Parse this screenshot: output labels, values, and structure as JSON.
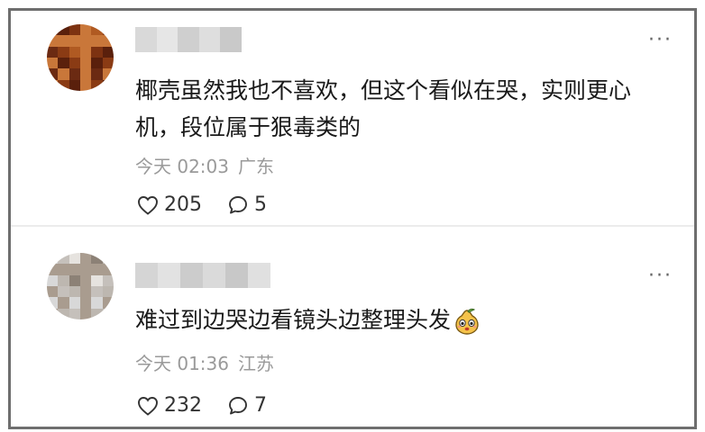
{
  "comments": [
    {
      "text": "椰壳虽然我也不喜欢，但这个看似在哭，实则更心机，段位属于狠毒类的",
      "time": "今天 02:03",
      "location": "广东",
      "likes": "205",
      "replies": "5",
      "avatar_colors": [
        "#6b2a12",
        "#8a3b14",
        "#b05a22",
        "#c9773a",
        "#7d3211",
        "#5a200c"
      ],
      "username_colors": [
        "#d9d9d9",
        "#e6e6e6",
        "#cfcfcf",
        "#dedede",
        "#c9c9c9"
      ]
    },
    {
      "text": "难过到边哭边看镜头边整理头发",
      "time": "今天 01:36",
      "location": "江苏",
      "likes": "232",
      "replies": "7",
      "avatar_colors": [
        "#d8d8d8",
        "#bdb7b0",
        "#8c8176",
        "#a99c8f",
        "#e6e3df",
        "#c5c0bb"
      ],
      "username_colors": [
        "#d5d5d5",
        "#e2e2e2",
        "#cccccc",
        "#dadada",
        "#c8c8c8",
        "#e0e0e0"
      ]
    }
  ],
  "icons": {
    "more": "more-dots-icon",
    "like": "heart-outline-icon",
    "reply": "comment-bubble-icon",
    "emoji": "pear-face-emoji"
  }
}
